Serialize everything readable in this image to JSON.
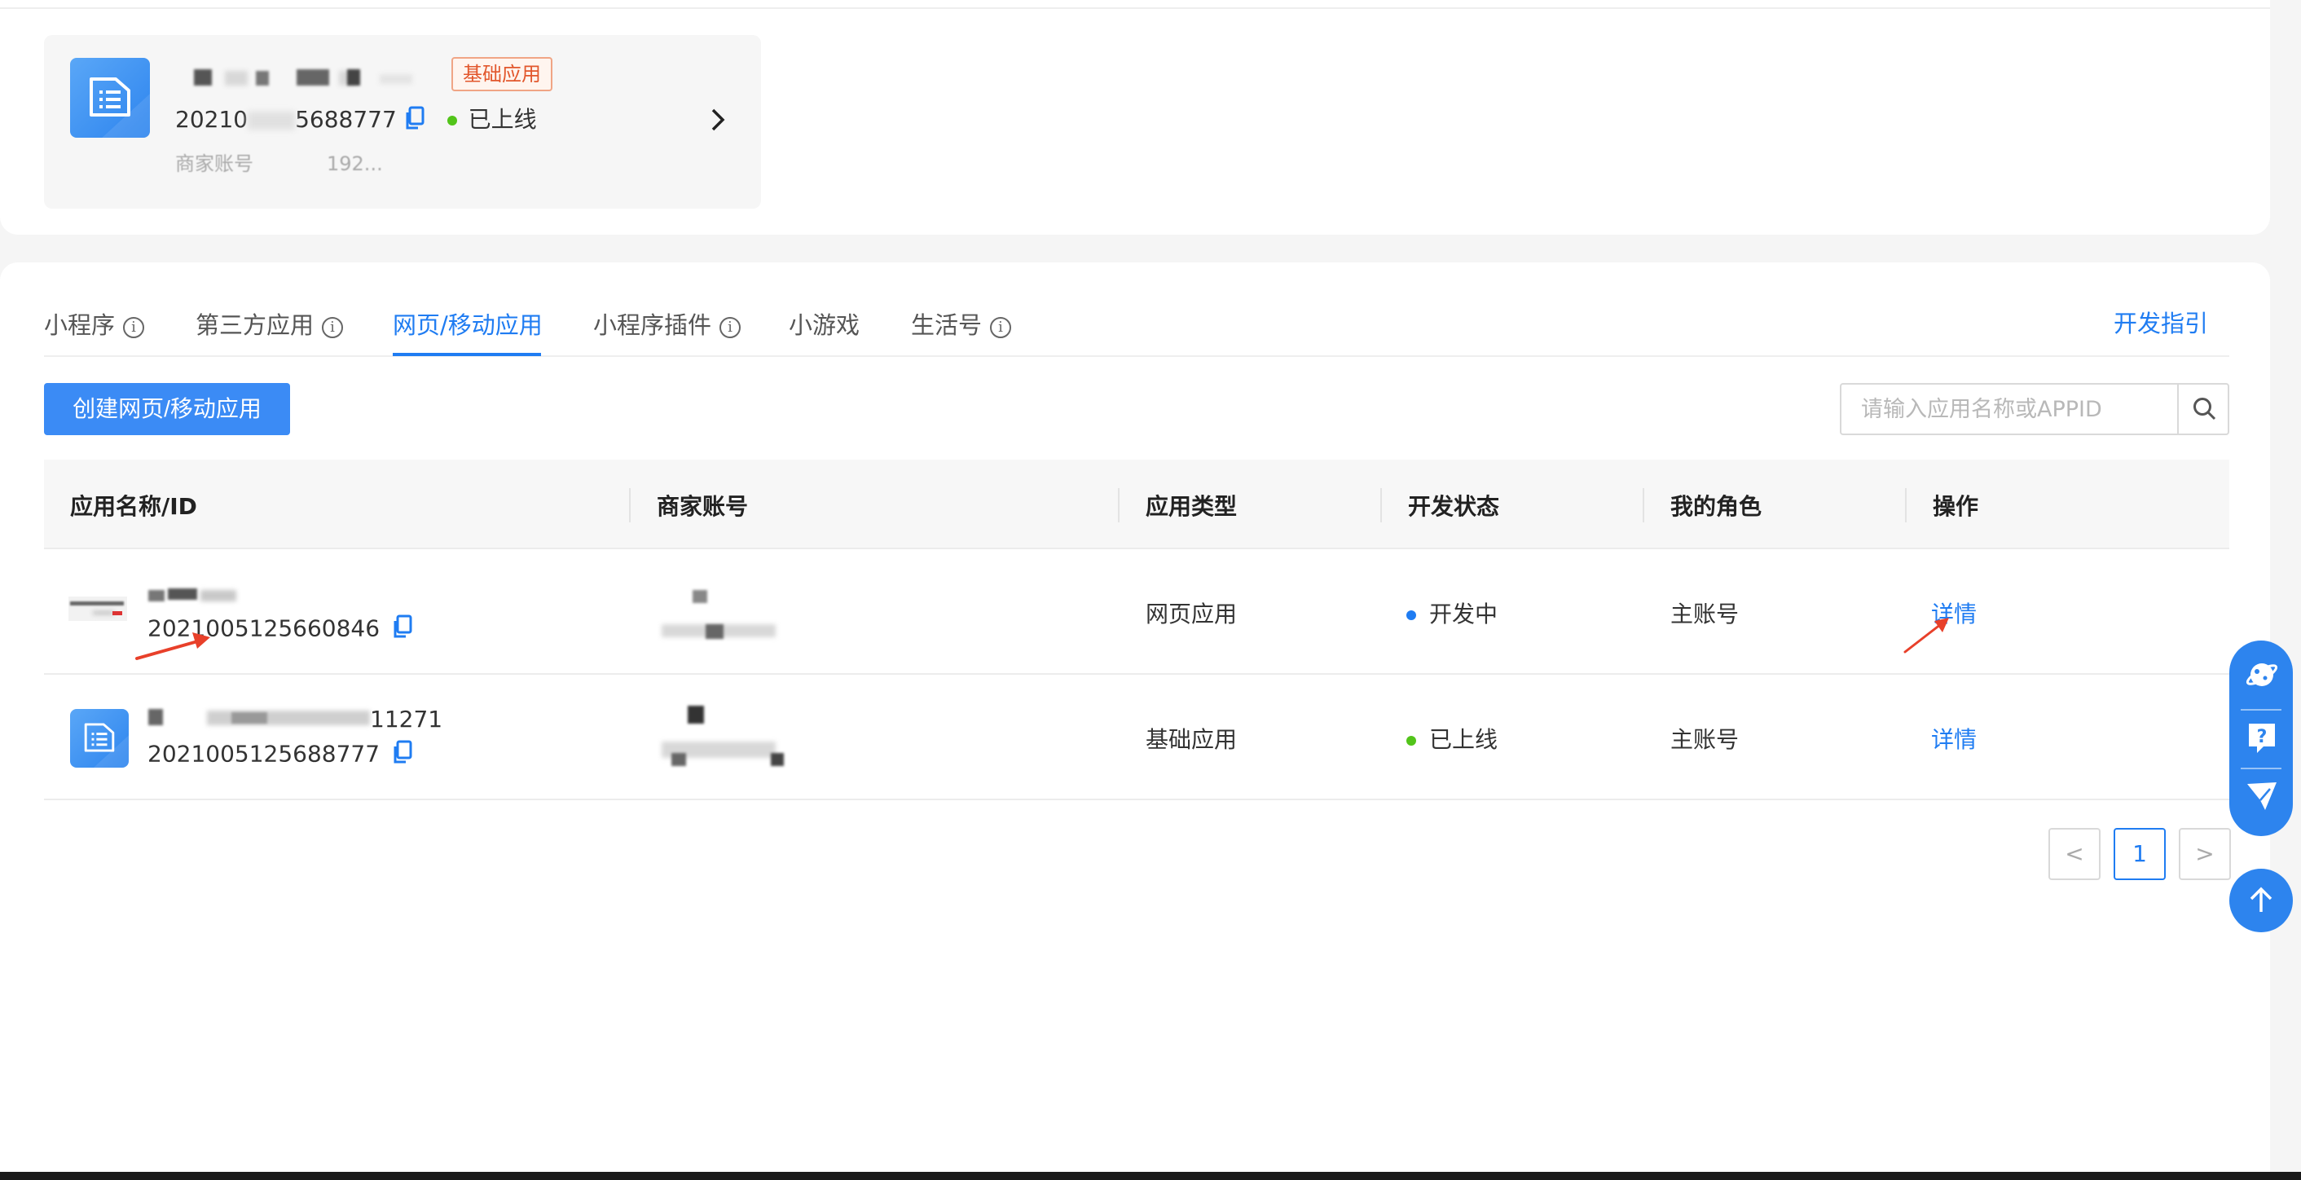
{
  "app_card": {
    "name_partial": "",
    "badge": "基础应用",
    "id_prefix": "20210",
    "id_suffix": "5688777",
    "status": "已上线",
    "account_prefix": "商家账号",
    "account_tail": "192..."
  },
  "tabs": [
    {
      "label": "小程序",
      "info": true
    },
    {
      "label": "第三方应用",
      "info": true
    },
    {
      "label": "网页/移动应用",
      "active": true
    },
    {
      "label": "小程序插件",
      "info": true
    },
    {
      "label": "小游戏"
    },
    {
      "label": "生活号",
      "info": true
    }
  ],
  "dev_guide": "开发指引",
  "create_button": "创建网页/移动应用",
  "search": {
    "placeholder": "请输入应用名称或APPID"
  },
  "table": {
    "headers": [
      "应用名称/ID",
      "商家账号",
      "应用类型",
      "开发状态",
      "我的角色",
      "操作"
    ],
    "rows": [
      {
        "id": "2021005125660846",
        "type": "网页应用",
        "status": "开发中",
        "status_color": "#1f7cf2",
        "role": "主账号",
        "action": "详情"
      },
      {
        "name_visible": "11271",
        "id": "2021005125688777",
        "type": "基础应用",
        "status": "已上线",
        "status_color": "#52c41a",
        "role": "主账号",
        "action": "详情"
      }
    ]
  },
  "pagination": {
    "prev": "<",
    "current": "1",
    "next": ">"
  },
  "colors": {
    "accent": "#1f7cf2",
    "online": "#52c41a",
    "badge": "#e2572c",
    "annotation_arrow": "#e8402a"
  },
  "float_icons": [
    "planet-icon",
    "help-icon",
    "feedback-icon",
    "back-to-top-icon"
  ]
}
